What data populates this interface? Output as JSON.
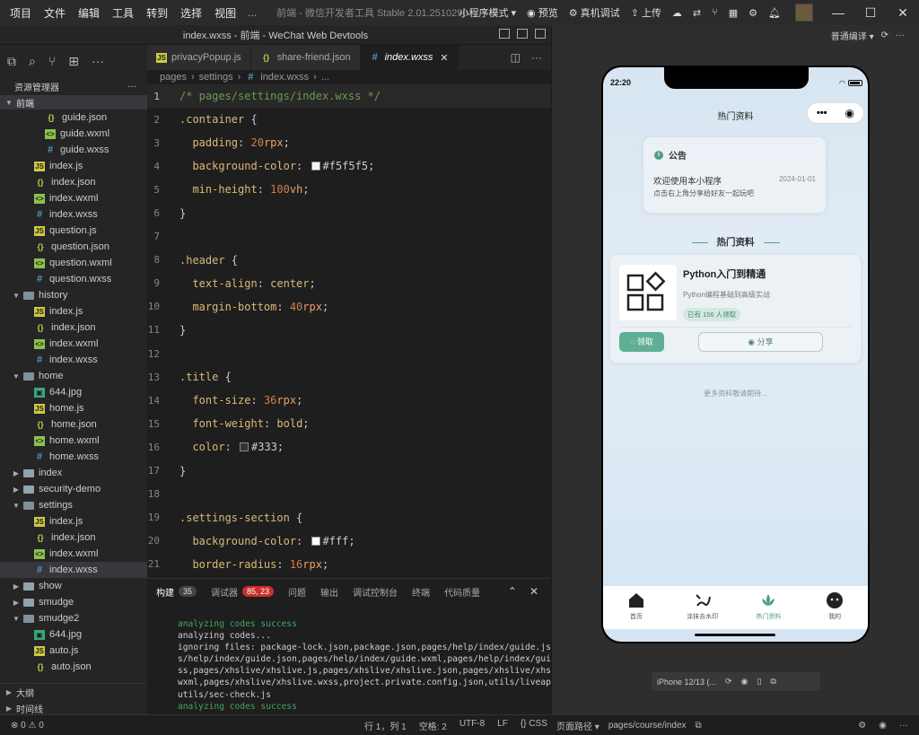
{
  "menubar": {
    "items": [
      "项目",
      "文件",
      "编辑",
      "工具",
      "转到",
      "选择",
      "视图"
    ],
    "more": "...",
    "window_title": "前端 - 微信开发者工具 Stable 2.01.2510290",
    "mode": "小程序模式",
    "preview": "预览",
    "real_debug": "真机调试",
    "upload": "上传"
  },
  "editor_title": "index.wxss - 前端 - WeChat Web Devtools",
  "explorer": {
    "title": "资源管理器",
    "root": "前端",
    "rows": [
      {
        "name": "guide.json",
        "type": "json",
        "indent": 3
      },
      {
        "name": "guide.wxml",
        "type": "wxml",
        "indent": 3
      },
      {
        "name": "guide.wxss",
        "type": "wxss",
        "indent": 3
      },
      {
        "name": "index.js",
        "type": "js",
        "indent": 2
      },
      {
        "name": "index.json",
        "type": "json",
        "indent": 2
      },
      {
        "name": "index.wxml",
        "type": "wxml",
        "indent": 2
      },
      {
        "name": "index.wxss",
        "type": "wxss",
        "indent": 2
      },
      {
        "name": "question.js",
        "type": "js",
        "indent": 2
      },
      {
        "name": "question.json",
        "type": "json",
        "indent": 2
      },
      {
        "name": "question.wxml",
        "type": "wxml",
        "indent": 2
      },
      {
        "name": "question.wxss",
        "type": "wxss",
        "indent": 2
      },
      {
        "name": "history",
        "type": "folderopen",
        "indent": 1
      },
      {
        "name": "index.js",
        "type": "js",
        "indent": 2
      },
      {
        "name": "index.json",
        "type": "json",
        "indent": 2
      },
      {
        "name": "index.wxml",
        "type": "wxml",
        "indent": 2
      },
      {
        "name": "index.wxss",
        "type": "wxss",
        "indent": 2
      },
      {
        "name": "home",
        "type": "folderopen",
        "indent": 1
      },
      {
        "name": "644.jpg",
        "type": "jpg",
        "indent": 2
      },
      {
        "name": "home.js",
        "type": "js",
        "indent": 2
      },
      {
        "name": "home.json",
        "type": "json",
        "indent": 2
      },
      {
        "name": "home.wxml",
        "type": "wxml",
        "indent": 2
      },
      {
        "name": "home.wxss",
        "type": "wxss",
        "indent": 2
      },
      {
        "name": "index",
        "type": "folder",
        "indent": 1
      },
      {
        "name": "security-demo",
        "type": "folder",
        "indent": 1
      },
      {
        "name": "settings",
        "type": "folderopen",
        "indent": 1
      },
      {
        "name": "index.js",
        "type": "js",
        "indent": 2
      },
      {
        "name": "index.json",
        "type": "json",
        "indent": 2
      },
      {
        "name": "index.wxml",
        "type": "wxml",
        "indent": 2
      },
      {
        "name": "index.wxss",
        "type": "wxss",
        "indent": 2,
        "selected": true
      },
      {
        "name": "show",
        "type": "folder",
        "indent": 1
      },
      {
        "name": "smudge",
        "type": "folder",
        "indent": 1
      },
      {
        "name": "smudge2",
        "type": "folderopen",
        "indent": 1
      },
      {
        "name": "644.jpg",
        "type": "jpg",
        "indent": 2
      },
      {
        "name": "auto.js",
        "type": "js",
        "indent": 2
      },
      {
        "name": "auto.json",
        "type": "json",
        "indent": 2
      }
    ],
    "outline": "大纲",
    "timeline": "时间线"
  },
  "tabs": [
    {
      "label": "privacyPopup.js",
      "icon": "js"
    },
    {
      "label": "share-friend.json",
      "icon": "json"
    },
    {
      "label": "index.wxss",
      "icon": "wxss",
      "active": true
    }
  ],
  "breadcrumb": [
    "pages",
    "settings",
    "index.wxss",
    "..."
  ],
  "code_lines": [
    [
      [
        "cm",
        "/* pages/settings/index.wxss */"
      ]
    ],
    [
      [
        "sel-c",
        ".container"
      ],
      [
        "txt",
        " {"
      ]
    ],
    [
      [
        "txt",
        "  "
      ],
      [
        "prop",
        "padding"
      ],
      [
        "txt",
        ": "
      ],
      [
        "num",
        "20"
      ],
      [
        "kw",
        "rpx"
      ],
      [
        "txt",
        ";"
      ]
    ],
    [
      [
        "txt",
        "  "
      ],
      [
        "prop",
        "background-color"
      ],
      [
        "txt",
        ": "
      ],
      [
        "sw",
        "#f5f5f5"
      ],
      [
        "txt",
        "#f5f5f5;"
      ]
    ],
    [
      [
        "txt",
        "  "
      ],
      [
        "prop",
        "min-height"
      ],
      [
        "txt",
        ": "
      ],
      [
        "num",
        "100"
      ],
      [
        "kw",
        "vh"
      ],
      [
        "txt",
        ";"
      ]
    ],
    [
      [
        "txt",
        "}"
      ]
    ],
    [],
    [
      [
        "sel-c",
        ".header"
      ],
      [
        "txt",
        " {"
      ]
    ],
    [
      [
        "txt",
        "  "
      ],
      [
        "prop",
        "text-align"
      ],
      [
        "txt",
        ": "
      ],
      [
        "prop",
        "center"
      ],
      [
        "txt",
        ";"
      ]
    ],
    [
      [
        "txt",
        "  "
      ],
      [
        "prop",
        "margin-bottom"
      ],
      [
        "txt",
        ": "
      ],
      [
        "num",
        "40"
      ],
      [
        "kw",
        "rpx"
      ],
      [
        "txt",
        ";"
      ]
    ],
    [
      [
        "txt",
        "}"
      ]
    ],
    [],
    [
      [
        "sel-c",
        ".title"
      ],
      [
        "txt",
        " {"
      ]
    ],
    [
      [
        "txt",
        "  "
      ],
      [
        "prop",
        "font-size"
      ],
      [
        "txt",
        ": "
      ],
      [
        "num",
        "36"
      ],
      [
        "kw",
        "rpx"
      ],
      [
        "txt",
        ";"
      ]
    ],
    [
      [
        "txt",
        "  "
      ],
      [
        "prop",
        "font-weight"
      ],
      [
        "txt",
        ": "
      ],
      [
        "prop",
        "bold"
      ],
      [
        "txt",
        ";"
      ]
    ],
    [
      [
        "txt",
        "  "
      ],
      [
        "prop",
        "color"
      ],
      [
        "txt",
        ": "
      ],
      [
        "sw",
        "#333"
      ],
      [
        "txt",
        "#333;"
      ]
    ],
    [
      [
        "txt",
        "}"
      ]
    ],
    [],
    [
      [
        "sel-c",
        ".settings-section"
      ],
      [
        "txt",
        " {"
      ]
    ],
    [
      [
        "txt",
        "  "
      ],
      [
        "prop",
        "background-color"
      ],
      [
        "txt",
        ": "
      ],
      [
        "sw",
        "#fff"
      ],
      [
        "txt",
        "#fff;"
      ]
    ],
    [
      [
        "txt",
        "  "
      ],
      [
        "prop",
        "border-radius"
      ],
      [
        "txt",
        ": "
      ],
      [
        "num",
        "16"
      ],
      [
        "kw",
        "rpx"
      ],
      [
        "txt",
        ";"
      ]
    ]
  ],
  "panel": {
    "tabs": [
      {
        "label": "构建",
        "badge": "35",
        "active": true
      },
      {
        "label": "调试器",
        "badge": "85, 23",
        "red": true
      },
      {
        "label": "问题"
      },
      {
        "label": "输出"
      },
      {
        "label": "调试控制台"
      },
      {
        "label": "终端"
      },
      {
        "label": "代码质量"
      }
    ],
    "output": [
      {
        "t": "analyzing codes success",
        "g": true
      },
      {
        "t": "analyzing codes..."
      },
      {
        "t": "ignoring files: package-lock.json,package.json,pages/help/index/guide.js,"
      },
      {
        "t": "s/help/index/guide.json,pages/help/index/guide.wxml,pages/help/index/guid"
      },
      {
        "t": "ss,pages/xhslive/xhslive.js,pages/xhslive/xhslive.json,pages/xhslive/xhsl"
      },
      {
        "t": "wxml,pages/xhslive/xhslive.wxss,project.private.config.json,utils/liveapi"
      },
      {
        "t": "utils/sec-check.js"
      },
      {
        "t": "analyzing codes success",
        "g": true
      }
    ]
  },
  "status": {
    "errors": "0",
    "warnings": "0",
    "position": "行 1，列 1",
    "spaces": "空格: 2",
    "encoding": "UTF-8",
    "eol": "LF",
    "lang": "CSS",
    "page_path_label": "页面路径",
    "page_path": "pages/course/index"
  },
  "simulator": {
    "compile_mode": "普通编译",
    "time": "22:20",
    "nav_title": "热门资料",
    "notice": {
      "title": "公告",
      "msg1": "欢迎使用本小程序",
      "msg2": "点击右上角分享给好友一起玩吧",
      "date": "2024-01-01"
    },
    "section_title": "热门资料",
    "card": {
      "title": "Python入门到精通",
      "subtitle": "Python编程基础到高级实战",
      "tag": "已有 156 人领取",
      "get": "领取",
      "share": "分享"
    },
    "more": "更多资料敬请期待...",
    "tabbar": [
      {
        "label": "首页"
      },
      {
        "label": "涂抹去水印"
      },
      {
        "label": "热门资料",
        "active": true
      },
      {
        "label": "我的"
      }
    ],
    "device": "iPhone 12/13 (..."
  }
}
